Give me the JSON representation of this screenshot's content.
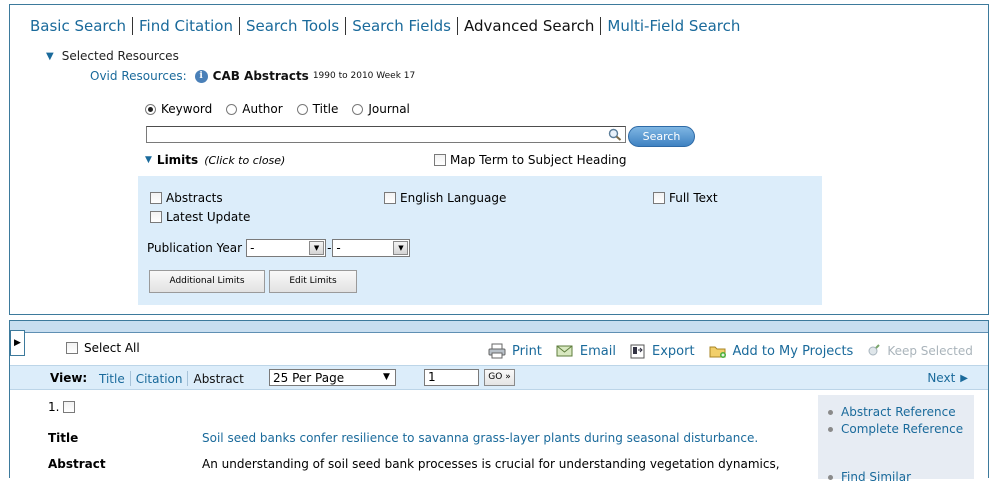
{
  "nav_tabs": [
    "Basic Search",
    "Find Citation",
    "Search Tools",
    "Search Fields",
    "Advanced Search",
    "Multi-Field Search"
  ],
  "active_tab": "Advanced Search",
  "selected_resources": {
    "label": "Selected Resources",
    "ovid_label": "Ovid Resources:",
    "resource_name": "CAB Abstracts",
    "resource_range": "1990 to 2010 Week 17"
  },
  "search": {
    "types": [
      "Keyword",
      "Author",
      "Title",
      "Journal"
    ],
    "selected_type": "Keyword",
    "query_value": "",
    "search_button": "Search"
  },
  "limits": {
    "label": "Limits",
    "hint": "(Click to close)",
    "map_term_label": "Map Term to Subject Heading",
    "checkboxes": [
      "Abstracts",
      "English Language",
      "Full Text",
      "Latest Update"
    ],
    "pub_year_label": "Publication Year",
    "pub_year_from": "-",
    "pub_year_to": "-",
    "dash": "-",
    "additional_limits_button": "Additional Limits",
    "edit_limits_button": "Edit Limits"
  },
  "results_toolbar": {
    "select_all": "Select All",
    "actions": [
      "Print",
      "Email",
      "Export",
      "Add to My Projects",
      "Keep Selected"
    ]
  },
  "viewbar": {
    "view_label": "View:",
    "views": [
      "Title",
      "Citation",
      "Abstract"
    ],
    "current_view": "Abstract",
    "per_page": "25 Per Page",
    "page_number": "1",
    "go_button": "GO »",
    "next_label": "Next"
  },
  "record": {
    "number": "1.",
    "title_label": "Title",
    "title_value": "Soil seed banks confer resilience to savanna grass-layer plants during seasonal disturbance.",
    "abstract_label": "Abstract",
    "abstract_value": "An understanding of soil seed bank processes is crucial for understanding vegetation dynamics,"
  },
  "record_links": [
    "Abstract Reference",
    "Complete Reference",
    "Find Similar"
  ],
  "colors": {
    "link": "#1a6a9b",
    "panel_border": "#3d7a9c",
    "limits_bg": "#dcedfa",
    "search_button": "#3f82c2"
  }
}
